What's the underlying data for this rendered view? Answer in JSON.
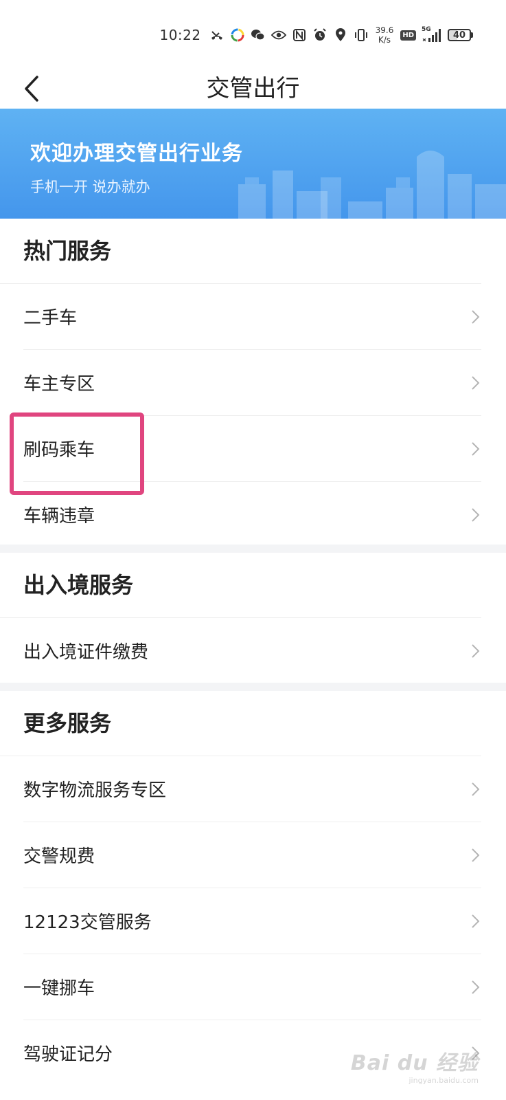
{
  "status_bar": {
    "time": "10:22",
    "net_speed_value": "39.6",
    "net_speed_unit": "K/s",
    "hd_label": "HD",
    "signal_label": "5G",
    "battery_level": "40"
  },
  "nav": {
    "title": "交管出行"
  },
  "banner": {
    "title": "欢迎办理交管出行业务",
    "subtitle": "手机一开 说办就办"
  },
  "sections": {
    "hot": {
      "title": "热门服务",
      "items": [
        {
          "label": "二手车"
        },
        {
          "label": "车主专区"
        },
        {
          "label": "刷码乘车"
        },
        {
          "label": "车辆违章"
        }
      ]
    },
    "border": {
      "title": "出入境服务",
      "items": [
        {
          "label": "出入境证件缴费"
        }
      ]
    },
    "more": {
      "title": "更多服务",
      "items": [
        {
          "label": "数字物流服务专区"
        },
        {
          "label": "交警规费"
        },
        {
          "label": "12123交管服务"
        },
        {
          "label": "一键挪车"
        },
        {
          "label": "驾驶证记分"
        }
      ]
    }
  },
  "watermark": {
    "main": "Bai du 经验",
    "url": "jingyan.baidu.com"
  },
  "colors": {
    "banner_top": "#5fb2f3",
    "banner_bottom": "#4496ec",
    "highlight": "#e0457f"
  }
}
